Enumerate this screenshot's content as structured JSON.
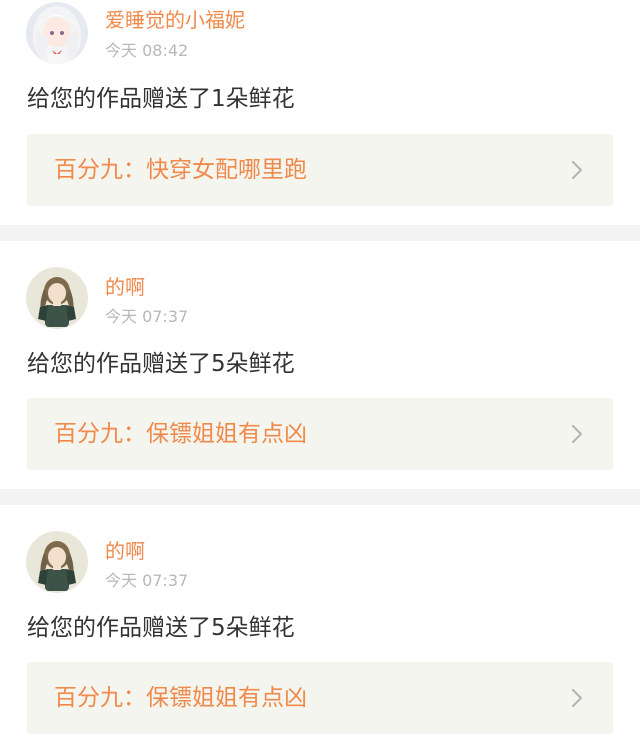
{
  "notifications": [
    {
      "username": "爱睡觉的小福妮",
      "time": "今天 08:42",
      "message": "给您的作品赠送了1朵鲜花",
      "work_title": "百分九：快穿女配哪里跑"
    },
    {
      "username": "的啊",
      "time": "今天 07:37",
      "message": "给您的作品赠送了5朵鲜花",
      "work_title": "百分九：保镖姐姐有点凶"
    },
    {
      "username": "的啊",
      "time": "今天 07:37",
      "message": "给您的作品赠送了5朵鲜花",
      "work_title": "百分九：保镖姐姐有点凶"
    }
  ],
  "colors": {
    "accent": "#f08a4b",
    "text": "#333333",
    "muted": "#b8b8b8",
    "page_bg": "#f3f3f3",
    "link_bg": "#f5f5f0"
  },
  "icons": {
    "avatar_1": "anime-girl-white-hair-avatar",
    "avatar_2": "anime-girl-green-dress-avatar",
    "chevron": "chevron-right-icon"
  }
}
